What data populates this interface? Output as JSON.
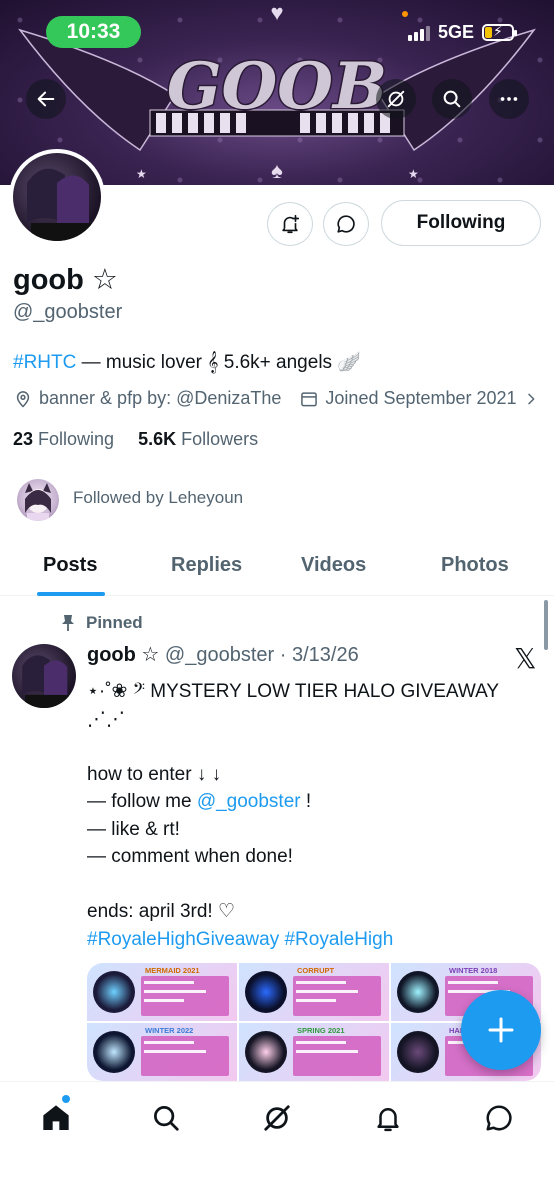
{
  "status_bar": {
    "time": "10:33",
    "network": "5GE"
  },
  "banner": {
    "logo_text": "GOOB"
  },
  "profile": {
    "display_name": "goob ☆",
    "handle": "@_goobster",
    "bio_tag": "#RHTC",
    "bio_text": " — music lover 𝄞 5.6k+ angels 🪽",
    "location": "banner & pfp by: @DenizaThe",
    "joined": "Joined September 2021",
    "following_count": "23",
    "following_label": " Following",
    "followers_count": "5.6K",
    "followers_label": " Followers",
    "followed_by": "Followed by Leheyoun",
    "follow_button": "Following"
  },
  "tabs": [
    {
      "label": "Posts"
    },
    {
      "label": "Replies"
    },
    {
      "label": "Videos"
    },
    {
      "label": "Photos"
    }
  ],
  "post": {
    "pinned_label": "Pinned",
    "author_name": "goob ☆",
    "author_handle": "@_goobster",
    "date": "· 3/13/26",
    "line1": "⋆·˚❀ 𝄢 MYSTERY LOW TIER HALO GIVEAWAY ⋰⋰",
    "line2": "how to enter ↓ ↓",
    "line3_prefix": "— follow me ",
    "line3_link": "@_goobster",
    "line3_suffix": " !",
    "line4": "— like & rt!",
    "line5": "— comment when done!",
    "line6": "ends: april 3rd! ♡",
    "hashtags": "#RoyaleHighGiveaway #RoyaleHigh",
    "media_titles": [
      "MERMAID 2021",
      "CORRUPT",
      "WINTER 2018",
      "WINTER 2022",
      "SPRING 2021",
      "HALO"
    ]
  },
  "colors": {
    "accent": "#1d9bf0",
    "muted": "#536471",
    "text": "#0f1419"
  }
}
